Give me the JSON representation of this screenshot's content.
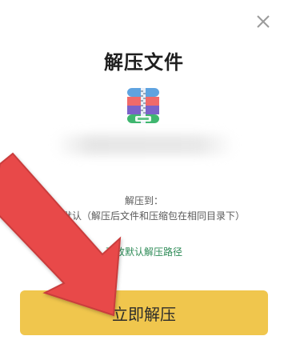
{
  "dialog": {
    "title": "解压文件",
    "file_icon": "zip-archive-icon",
    "extract_to_label": "解压到：",
    "extract_to_value": "系统默认（解压后文件和压缩包在相同目录下）",
    "change_path_link": "更改默认解压路径",
    "primary_button_label": "立即解压",
    "close_icon": "close-icon"
  },
  "colors": {
    "button_bg": "#f0c64d",
    "link": "#2e8b57",
    "arrow": "#e84a4a"
  }
}
